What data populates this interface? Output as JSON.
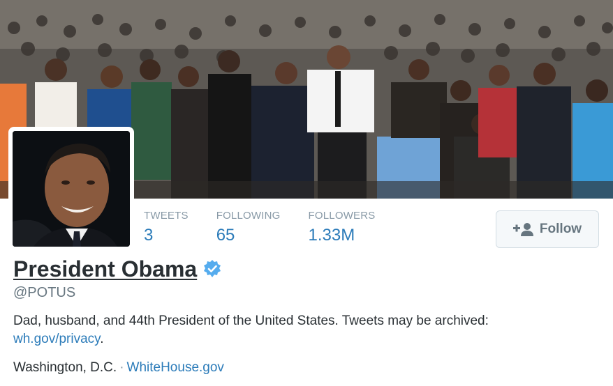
{
  "banner": {
    "image": "march-crowd-photo"
  },
  "avatar": {
    "image": "profile-portrait-photo"
  },
  "stats": [
    {
      "label": "TWEETS",
      "value": "3"
    },
    {
      "label": "FOLLOWING",
      "value": "65"
    },
    {
      "label": "FOLLOWERS",
      "value": "1.33M"
    }
  ],
  "follow_button": {
    "label": "Follow",
    "icon": "add-person-icon"
  },
  "profile": {
    "name": "President Obama",
    "verified_icon": "verified-badge-icon",
    "handle": "@POTUS",
    "bio_text": "Dad, husband, and 44th President of the United States. Tweets may be archived:",
    "bio_link": "wh.gov/privacy",
    "bio_suffix": ".",
    "location": "Washington, D.C.",
    "separator": "·",
    "website": "WhiteHouse.gov"
  },
  "colors": {
    "link": "#2b7bb9",
    "verified": "#55acee",
    "text": "#292f33",
    "muted": "#66757f"
  }
}
